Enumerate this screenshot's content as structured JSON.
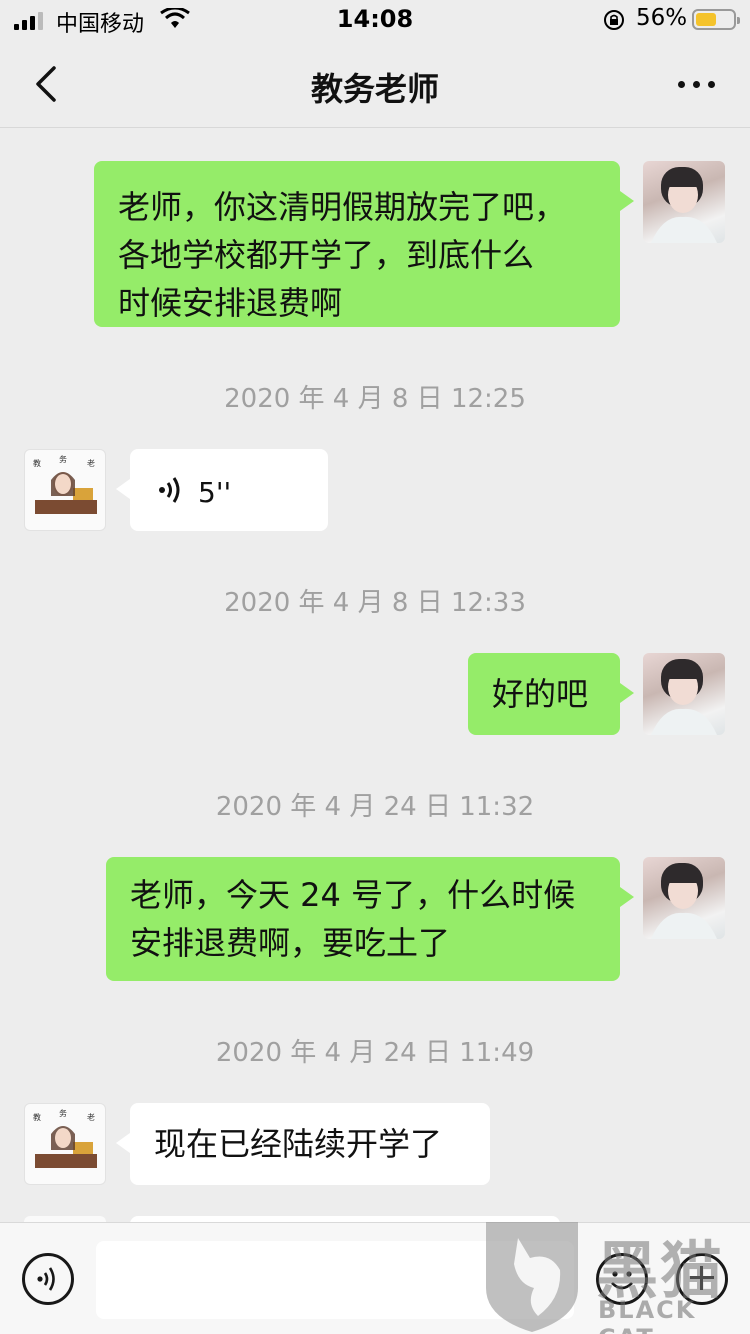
{
  "status_bar": {
    "carrier": "中国移动",
    "time": "14:08",
    "battery_percent": "56%",
    "battery_level": 0.56
  },
  "nav": {
    "title": "教务老师"
  },
  "messages": [
    {
      "from": "me",
      "type": "text",
      "text": "老师，你这清明假期放完了吧，\n各地学校都开学了，到底什么\n时候安排退费啊"
    },
    {
      "type": "timestamp",
      "text": "2020 年 4 月 8 日 12:25"
    },
    {
      "from": "teacher",
      "type": "voice",
      "duration": "5''"
    },
    {
      "type": "timestamp",
      "text": "2020 年 4 月 8 日 12:33"
    },
    {
      "from": "me",
      "type": "text",
      "text": "好的吧"
    },
    {
      "type": "timestamp",
      "text": "2020 年 4 月 24 日 11:32"
    },
    {
      "from": "me",
      "type": "text",
      "text": "老师，今天 24 号了，什么时候\n安排退费啊，要吃土了"
    },
    {
      "type": "timestamp",
      "text": "2020 年 4 月 24 日 11:49"
    },
    {
      "from": "teacher",
      "type": "text",
      "text": "现在已经陆续开学了"
    }
  ],
  "input_bar": {
    "placeholder": ""
  },
  "watermark": {
    "chinese": "黑猫",
    "english": "BLACK CAT"
  },
  "colors": {
    "background": "#ededed",
    "my_bubble": "#95ec69",
    "other_bubble": "#ffffff",
    "timestamp": "#a0a0a0",
    "battery": "#f4c32c"
  }
}
